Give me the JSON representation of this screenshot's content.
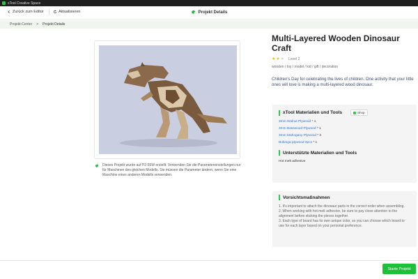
{
  "app": {
    "title": "xTool Creative Space"
  },
  "toolbar": {
    "back_label": "Zurück zum Editor",
    "refresh_label": "Aktualisieren",
    "center_title": "Projekt Details"
  },
  "breadcrumb": {
    "root": "Projekt-Center",
    "separator": ">",
    "current": "Projekt Details"
  },
  "project": {
    "title": "Multi-Layered Wooden Dinosaur Craft",
    "rating": {
      "value": 2,
      "max": 5,
      "level_label": "Level 2"
    },
    "tags": "wooden / toy / model / kid / gift / decoration",
    "description": "Children's Day for celebrating the lives of children. One activity that your little ones will love is making a multi-layered wood dinosaur.",
    "note": "Dieses Projekt wurde auf P2-55W erstellt. Verwenden Sie die Parametereinstellungen nur für Maschinen des gleichen Modells. Sie müssen die Parameter ändern, wenn Sie eine Maschine eines anderen Modells verwenden."
  },
  "materials_panel": {
    "title": "xTool Materialien und Tools",
    "shop_label": "Shop",
    "items": [
      {
        "name": "3mm Walnut Plywood",
        "qty": "* 1"
      },
      {
        "name": "3mm Basswood Plywood",
        "qty": "* 1"
      },
      {
        "name": "3mm Mahogany Plywood",
        "qty": "* 3"
      },
      {
        "name": "Bubinga plywood 4pcs",
        "qty": "* 1"
      }
    ],
    "supported_title": "Unterstützte Materialien und Tools",
    "supported_items": [
      "Hot melt adhesive"
    ]
  },
  "precautions": {
    "title": "Vorsichtsmaßnahmen",
    "lines": [
      "1. It's important to attach the dinosaur parts in the correct order when assembling.",
      "2. When working with hot melt adhesive, be sure to pay close attention to the alignment before sticking the pieces together.",
      "3. Each type of board has its own unique color, so you can choose which board to use for each layer based on your personal preference."
    ]
  },
  "footer": {
    "start_label": "Starte Projekt"
  },
  "colors": {
    "accent": "#1fbf3a",
    "link": "#2f6fd0",
    "star": "#f5b800",
    "image_bg": "#c9cee0"
  },
  "icons": {
    "back": "back-arrow-icon",
    "refresh": "refresh-icon",
    "project": "leaf-icon",
    "shop": "shop-icon"
  }
}
